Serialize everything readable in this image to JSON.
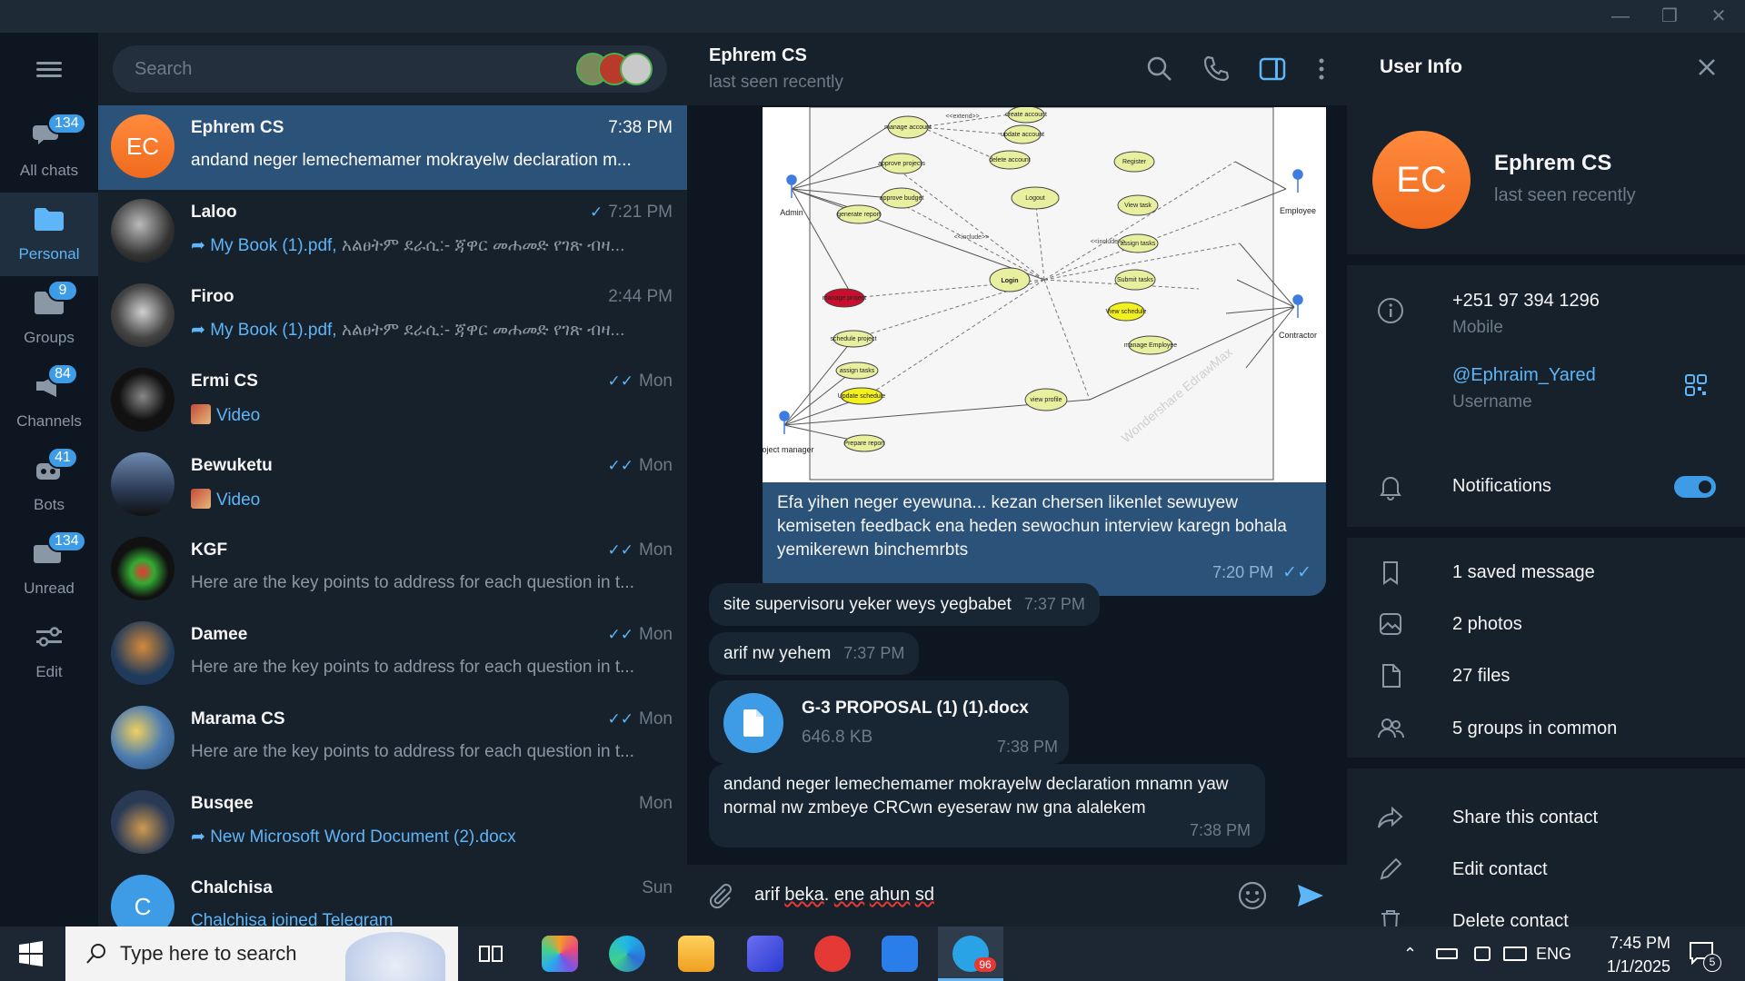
{
  "window": {
    "minimize": "—",
    "restore": "❐",
    "close": "✕"
  },
  "folders": [
    {
      "label": "All chats",
      "badge": "134",
      "icon": "chat-bubbles-icon"
    },
    {
      "label": "Personal",
      "badge": "",
      "icon": "folder-icon"
    },
    {
      "label": "Groups",
      "badge": "9",
      "icon": "groups-icon"
    },
    {
      "label": "Channels",
      "badge": "84",
      "icon": "megaphone-icon"
    },
    {
      "label": "Bots",
      "badge": "41",
      "icon": "bot-icon"
    },
    {
      "label": "Unread",
      "badge": "134",
      "icon": "unread-icon"
    },
    {
      "label": "Edit",
      "badge": "",
      "icon": "sliders-icon"
    }
  ],
  "search": {
    "placeholder": "Search"
  },
  "chats": [
    {
      "name": "Ephrem CS",
      "time": "7:38 PM",
      "initials": "EC",
      "preview_prefix": "",
      "preview": "andand neger lemechemamer mokrayelw declaration m...",
      "ticks": "",
      "color": "#f07a2a"
    },
    {
      "name": "Laloo",
      "time": "7:21 PM",
      "initials": "",
      "preview_prefix": "My Book (1).pdf,",
      "preview": " አልፀትም  ደራሲ:- ጃዋር መሐመድ  የገጽ ብዛ...",
      "ticks": "✓",
      "color": "#3a3a3a"
    },
    {
      "name": "Firoo",
      "time": "2:44 PM",
      "initials": "",
      "preview_prefix": "My Book (1).pdf,",
      "preview": " አልፀትም  ደራሲ:- ጃዋር መሐመድ  የገጽ ብዛ...",
      "ticks": "",
      "color": "#2d2d2d"
    },
    {
      "name": "Ermi CS",
      "time": "Mon",
      "initials": "",
      "preview_prefix": "Video",
      "preview": "",
      "ticks": "✓✓",
      "color": "#111111"
    },
    {
      "name": "Bewuketu",
      "time": "Mon",
      "initials": "",
      "preview_prefix": "Video",
      "preview": "",
      "ticks": "✓✓",
      "color": "#4a5a70"
    },
    {
      "name": "KGF",
      "time": "Mon",
      "initials": "",
      "preview_prefix": "",
      "preview": "Here are the key points to address for each question in t...",
      "ticks": "✓✓",
      "color": "#1b1b1b"
    },
    {
      "name": "Damee",
      "time": "Mon",
      "initials": "",
      "preview_prefix": "",
      "preview": "Here are the key points to address for each question in t...",
      "ticks": "✓✓",
      "color": "#2c4a6a"
    },
    {
      "name": "Marama CS",
      "time": "Mon",
      "initials": "",
      "preview_prefix": "",
      "preview": "Here are the key points to address for each question in t...",
      "ticks": "✓✓",
      "color": "#4c7cb0"
    },
    {
      "name": "Busqee",
      "time": "Mon",
      "initials": "",
      "preview_prefix": "New Microsoft Word Document (2).docx",
      "preview": "",
      "ticks": "",
      "color": "#2a3a55"
    },
    {
      "name": "Chalchisa",
      "time": "Sun",
      "initials": "C",
      "preview_prefix": "Chalchisa joined Telegram",
      "preview": "",
      "ticks": "",
      "color": "#3e9ce6"
    }
  ],
  "conversation": {
    "title": "Ephrem CS",
    "status": "last seen recently",
    "diagram": {
      "actors": [
        "Admin",
        "Employee",
        "Contractor",
        "project manager"
      ],
      "cases": [
        "manage account",
        "create account",
        "update account",
        "delete account",
        "approve projects",
        "approve budget",
        "generate report",
        "Logout",
        "Register",
        "View task",
        "assign tasks",
        "Submit tasks",
        "View schedule",
        "manage Employee",
        "Login",
        "manage project",
        "schedule project",
        "assign tasks",
        "Update schedule",
        "Prepare report",
        "view profile"
      ],
      "relations": [
        "<<extend>>",
        "<<include>>"
      ],
      "watermark": "Wondershare EdrawMax"
    },
    "messages": [
      {
        "dir": "out",
        "text": "Efa yihen neger eyewuna... kezan chersen likenlet sewuyew kemiseten feedback ena heden sewochun interview karegn bohala yemikerewn binchemrbts",
        "time": "7:20 PM"
      },
      {
        "dir": "in",
        "text": "site supervisoru yeker weys yegbabet",
        "time": "7:37 PM"
      },
      {
        "dir": "in",
        "text": "arif nw yehem",
        "time": "7:37 PM"
      },
      {
        "dir": "in",
        "file_name": "G-3 PROPOSAL (1) (1).docx",
        "file_size": "646.8 KB",
        "time": "7:38 PM"
      },
      {
        "dir": "in",
        "text": "andand neger lemechemamer mokrayelw declaration mnamn yaw normal nw zmbeye CRCwn eyeseraw nw gna alalekem",
        "time": "7:38 PM"
      }
    ],
    "composer": {
      "before": "arif ",
      "typo1": "beka",
      "mid": ". ",
      "typo2": "ene",
      "space": " ",
      "typo3": "ahun",
      "after": " ",
      "typo4": "sd"
    }
  },
  "user_info": {
    "title": "User Info",
    "initials": "EC",
    "name": "Ephrem CS",
    "status": "last seen recently",
    "phone": "+251 97 394 1296",
    "phone_label": "Mobile",
    "username": "@Ephraim_Yared",
    "username_label": "Username",
    "notifications": "Notifications",
    "media": [
      "1 saved message",
      "2 photos",
      "27 files",
      "5 groups in common"
    ],
    "actions": [
      "Share this contact",
      "Edit contact",
      "Delete contact"
    ]
  },
  "taskbar": {
    "search_placeholder": "Type here to search",
    "telegram_badge": "96",
    "lang": "ENG",
    "time": "7:45 PM",
    "date": "1/1/2025",
    "notif_count": "5"
  },
  "colors": {
    "accent": "#3e9ce6",
    "active_row": "#2b5278",
    "panel": "#17212b",
    "bg": "#0e1621"
  }
}
